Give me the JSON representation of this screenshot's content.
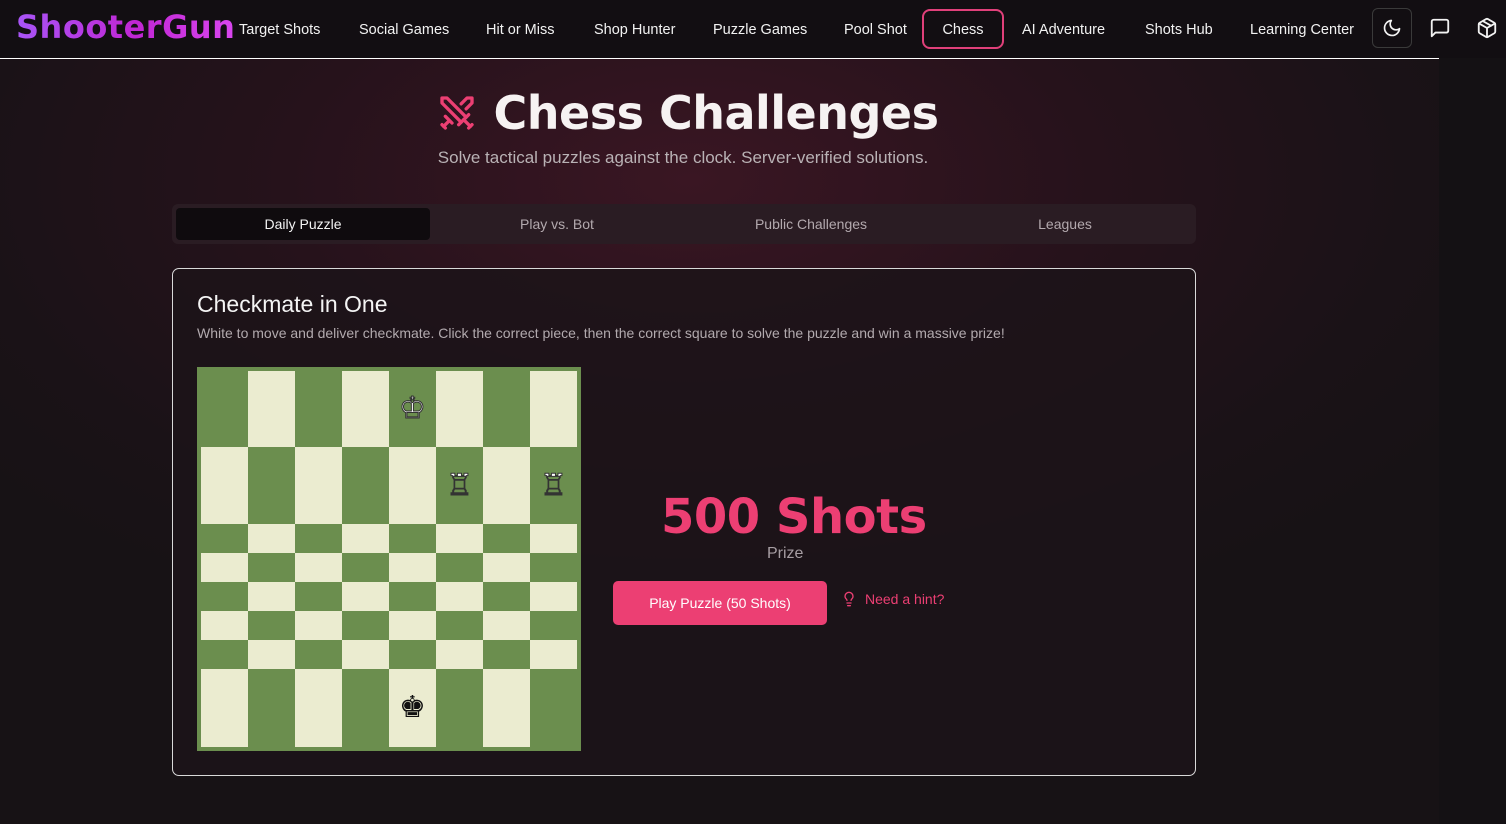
{
  "app": {
    "brand": "ShooterGun"
  },
  "nav": {
    "items": [
      {
        "label": "Target Shots"
      },
      {
        "label": "Social Games"
      },
      {
        "label": "Hit or Miss"
      },
      {
        "label": "Shop Hunter"
      },
      {
        "label": "Puzzle Games"
      },
      {
        "label": "Pool Shot"
      },
      {
        "label": "Chess",
        "active": true
      },
      {
        "label": "AI Adventure"
      },
      {
        "label": "Shots Hub"
      },
      {
        "label": "Learning Center"
      }
    ],
    "icons": [
      "moon-icon",
      "chat-icon",
      "package-icon"
    ]
  },
  "hero": {
    "title": "Chess Challenges",
    "subtitle": "Solve tactical puzzles against the clock. Server-verified solutions.",
    "icon": "crossed-swords-icon"
  },
  "tabs": [
    {
      "label": "Daily Puzzle",
      "active": true
    },
    {
      "label": "Play vs. Bot"
    },
    {
      "label": "Public Challenges"
    },
    {
      "label": "Leagues"
    }
  ],
  "puzzle": {
    "title": "Checkmate in One",
    "description": "White to move and deliver checkmate. Click the correct piece, then the correct square to solve the puzzle and win a massive prize!",
    "pieces": [
      {
        "glyph": "♔",
        "color": "white",
        "square": "e8",
        "name": "white-king"
      },
      {
        "glyph": "♖",
        "color": "white",
        "square": "f7",
        "name": "white-rook"
      },
      {
        "glyph": "♖",
        "color": "white",
        "square": "h7",
        "name": "white-rook"
      },
      {
        "glyph": "♚",
        "color": "black",
        "square": "e1",
        "name": "black-king"
      }
    ],
    "board_colors": {
      "light": "#ebecd0",
      "dark": "#6b8e4e"
    },
    "prize_value": "500 Shots",
    "prize_label": "Prize",
    "play_label": "Play Puzzle (50 Shots)",
    "hint_label": "Need a hint?"
  },
  "colors": {
    "accent": "#ec3f73",
    "brand_gradient_start": "#a855f7",
    "brand_gradient_end": "#d946ef"
  }
}
